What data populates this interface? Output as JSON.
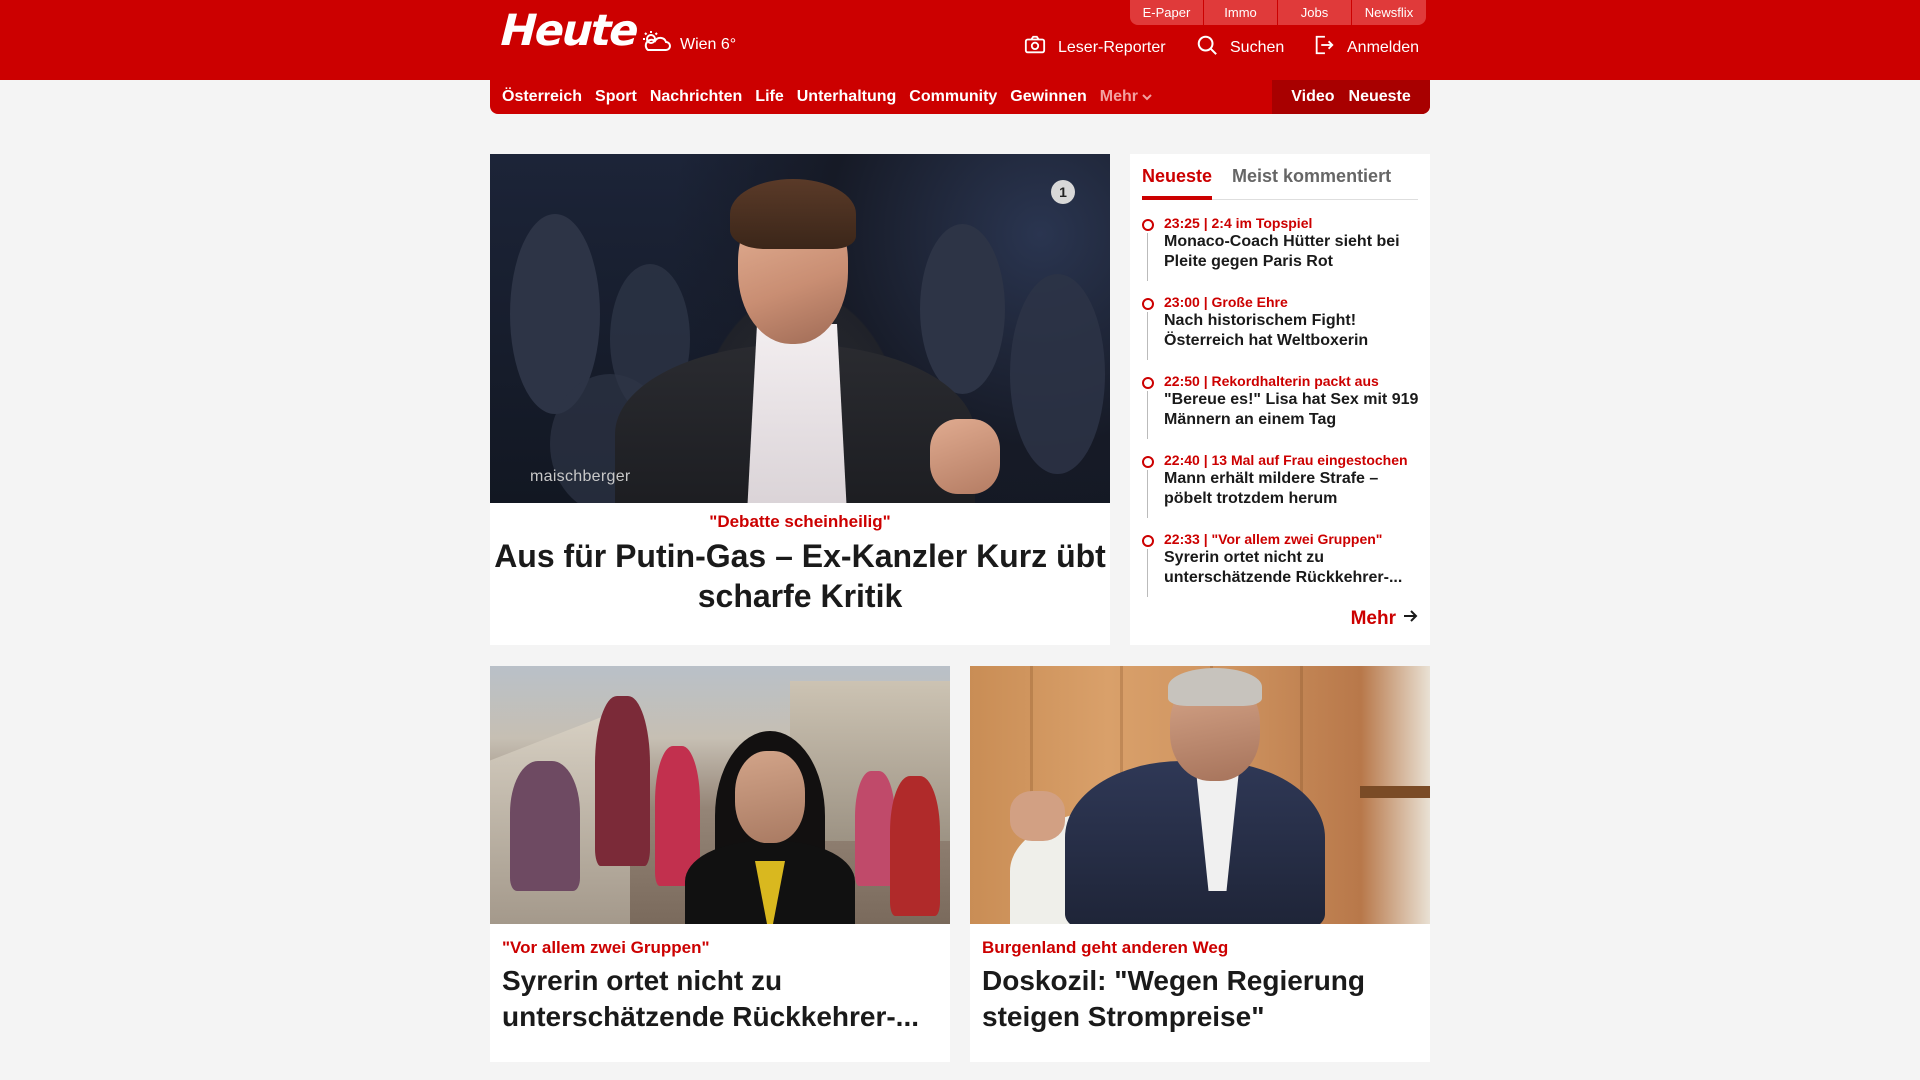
{
  "header": {
    "logo": "Heute",
    "weather": {
      "icon": "cloud-sun-icon",
      "text": "Wien 6°"
    },
    "service_tabs": [
      "E-Paper",
      "Immo",
      "Jobs",
      "Newsflix"
    ],
    "utility": {
      "reporter": "Leser-Reporter",
      "search": "Suchen",
      "login": "Anmelden"
    },
    "brand_color": "#cc0000"
  },
  "nav": {
    "items": [
      "Österreich",
      "Sport",
      "Nachrichten",
      "Life",
      "Unterhaltung",
      "Community",
      "Gewinnen"
    ],
    "more": "Mehr",
    "right": [
      "Video",
      "Neueste"
    ]
  },
  "hero": {
    "watermark": "maischberger",
    "badge": "1",
    "kicker": "\"Debatte scheinheilig\"",
    "title": "Aus für Putin-Gas – Ex-Kanzler Kurz übt scharfe Kritik"
  },
  "latest": {
    "tabs": [
      "Neueste",
      "Meist kommentiert"
    ],
    "items": [
      {
        "meta": "23:25 | 2:4 im Topspiel",
        "title": "Monaco-Coach Hütter sieht bei Pleite gegen Paris Rot"
      },
      {
        "meta": "23:00 | Große Ehre",
        "title": "Nach historischem Fight! Österreich hat Weltboxerin"
      },
      {
        "meta": "22:50 | Rekordhalterin packt aus",
        "title": "\"Bereue es!\" Lisa hat Sex mit 919 Männern an einem Tag"
      },
      {
        "meta": "22:40 | 13 Mal auf Frau eingestochen",
        "title": "Mann erhält mildere Strafe – pöbelt trotzdem herum"
      },
      {
        "meta": "22:33 | \"Vor allem zwei Gruppen\"",
        "title": "Syrerin ortet nicht zu unterschätzende Rückkehrer-..."
      }
    ],
    "more": "Mehr"
  },
  "cards": [
    {
      "kicker": "\"Vor allem zwei Gruppen\"",
      "title": "Syrerin ortet nicht zu unterschätzende Rückkehrer-..."
    },
    {
      "kicker": "Burgenland geht anderen Weg",
      "title": "Doskozil: \"Wegen Regierung steigen Strompreise\""
    }
  ]
}
